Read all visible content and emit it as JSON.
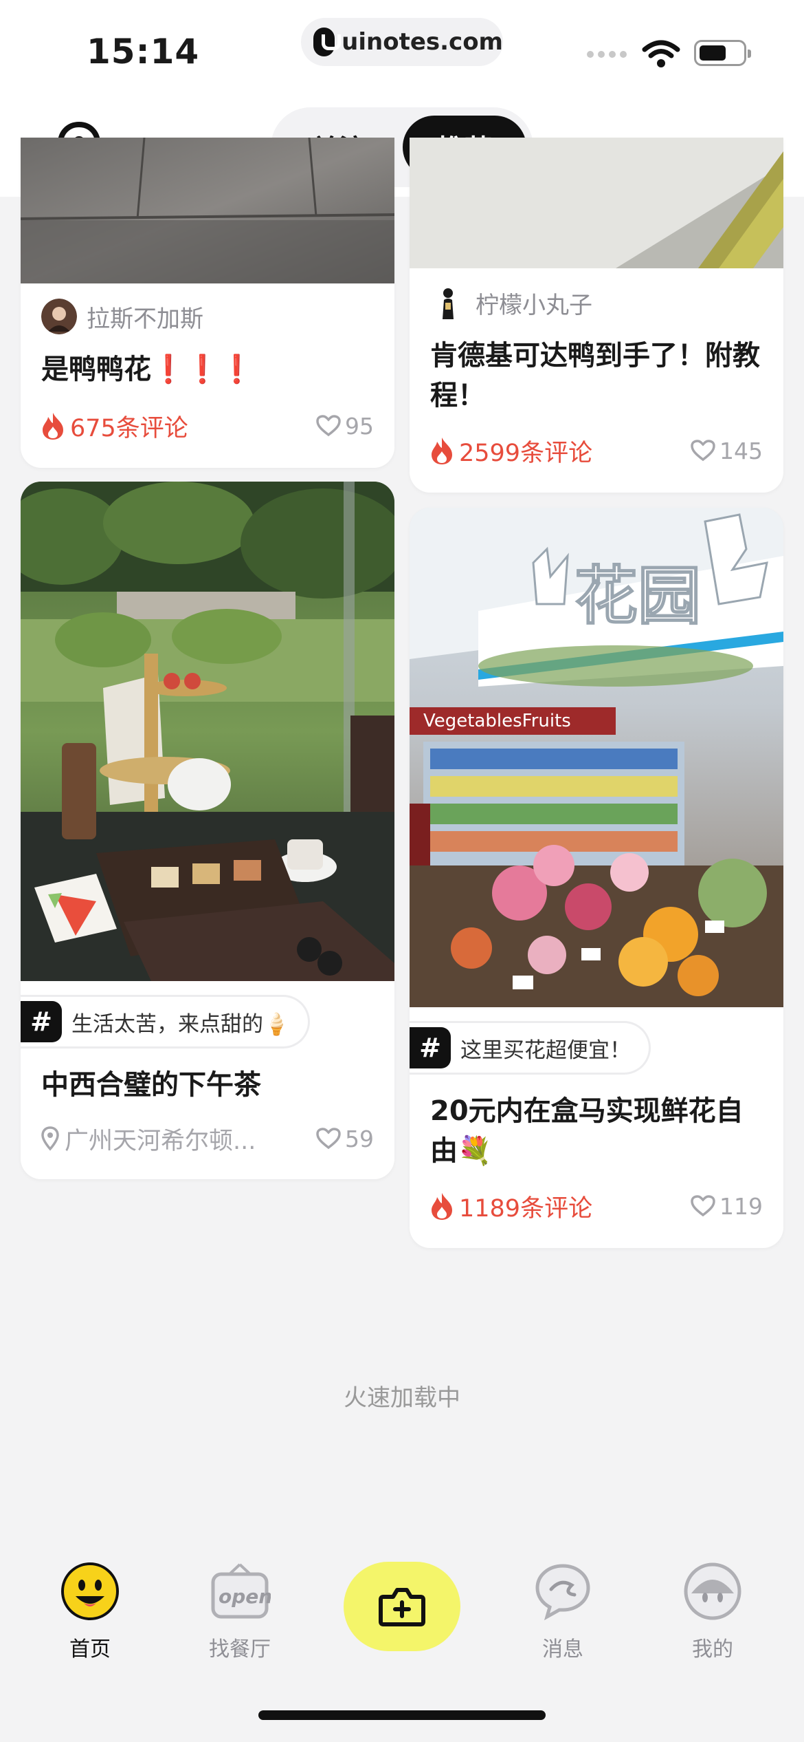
{
  "status_bar": {
    "time": "15:14",
    "url": "uinotes.com"
  },
  "header": {
    "tabs": [
      {
        "label": "关注",
        "selected": false
      },
      {
        "label": "推荐",
        "selected": true
      }
    ]
  },
  "feed": {
    "left": [
      {
        "author": "拉斯不加斯",
        "title": "是鸭鸭花❗️❗️❗️",
        "comments": "675条评论",
        "likes": "95"
      },
      {
        "topic": "生活太苦，来点甜的🍦",
        "title": "中西合璧的下午茶",
        "location": "广州天河希尔顿...",
        "likes": "59"
      }
    ],
    "right": [
      {
        "author": "柠檬小丸子",
        "title": "肯德基可达鸭到手了！附教程！",
        "comments": "2599条评论",
        "likes": "145"
      },
      {
        "topic": "这里买花超便宜！",
        "title": "20元内在盒马实现鲜花自由💐",
        "comments": "1189条评论",
        "likes": "119",
        "sign_text": "花园",
        "sign_sub": "VegetablesFruits"
      }
    ]
  },
  "loading_text": "火速加载中",
  "bottom_nav": [
    {
      "label": "首页",
      "icon": "smiley-home-icon",
      "active": true
    },
    {
      "label": "找餐厅",
      "icon": "open-sign-icon",
      "active": false
    },
    {
      "label": "",
      "icon": "camera-plus-icon",
      "active": false
    },
    {
      "label": "消息",
      "icon": "chat-bubble-icon",
      "active": false
    },
    {
      "label": "我的",
      "icon": "face-profile-icon",
      "active": false
    }
  ],
  "colors": {
    "accent_yellow": "#f4f56a",
    "comment_red": "#e74c3c",
    "tab_active": "#111111"
  }
}
